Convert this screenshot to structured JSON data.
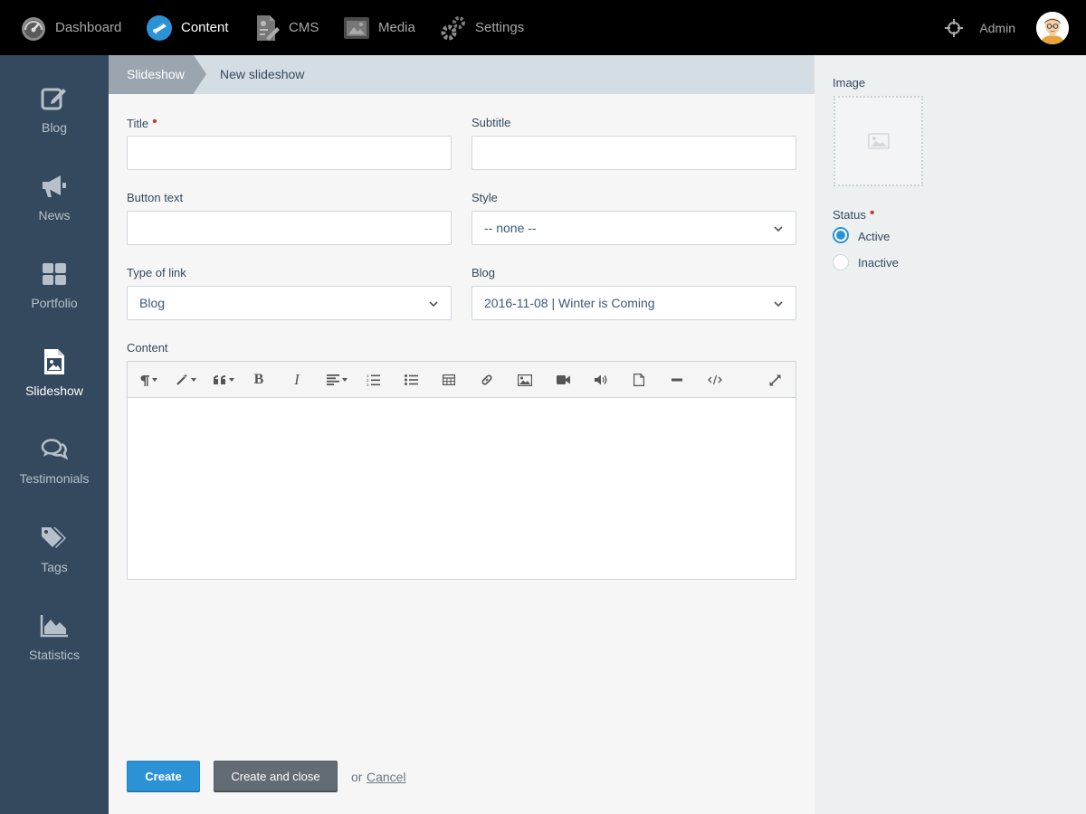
{
  "topnav": {
    "items": [
      {
        "label": "Dashboard",
        "icon": "speedometer-icon"
      },
      {
        "label": "Content",
        "icon": "content-icon",
        "active": true
      },
      {
        "label": "CMS",
        "icon": "cms-icon"
      },
      {
        "label": "Media",
        "icon": "media-icon"
      },
      {
        "label": "Settings",
        "icon": "gears-icon"
      }
    ],
    "admin_label": "Admin",
    "accent": "#2b93d5"
  },
  "sidebar": {
    "items": [
      {
        "label": "Blog",
        "icon": "edit-icon"
      },
      {
        "label": "News",
        "icon": "megaphone-icon"
      },
      {
        "label": "Portfolio",
        "icon": "grid-icon"
      },
      {
        "label": "Slideshow",
        "icon": "image-file-icon",
        "active": true
      },
      {
        "label": "Testimonials",
        "icon": "comments-icon"
      },
      {
        "label": "Tags",
        "icon": "tags-icon"
      },
      {
        "label": "Statistics",
        "icon": "area-chart-icon"
      }
    ]
  },
  "breadcrumb": {
    "parent": "Slideshow",
    "current": "New slideshow"
  },
  "form": {
    "title_label": "Title",
    "title_value": "",
    "subtitle_label": "Subtitle",
    "subtitle_value": "",
    "button_text_label": "Button text",
    "button_text_value": "",
    "style_label": "Style",
    "style_value": "-- none --",
    "type_of_link_label": "Type of link",
    "type_of_link_value": "Blog",
    "blog_label": "Blog",
    "blog_value": "2016-11-08 | Winter is Coming",
    "content_label": "Content"
  },
  "editor_toolbar": [
    "paragraph-icon",
    "magic-wand-icon",
    "quote-icon",
    "bold-icon",
    "italic-icon",
    "align-icon",
    "ordered-list-icon",
    "unordered-list-icon",
    "table-icon",
    "link-icon",
    "picture-icon",
    "video-icon",
    "audio-icon",
    "file-icon",
    "horizontal-rule-icon",
    "code-icon",
    "fullscreen-icon"
  ],
  "actions": {
    "create_label": "Create",
    "create_close_label": "Create and close",
    "or_text": "or",
    "cancel_label": "Cancel"
  },
  "right_panel": {
    "image_label": "Image",
    "status_label": "Status",
    "status_options": [
      {
        "label": "Active",
        "checked": true
      },
      {
        "label": "Inactive",
        "checked": false
      }
    ]
  }
}
